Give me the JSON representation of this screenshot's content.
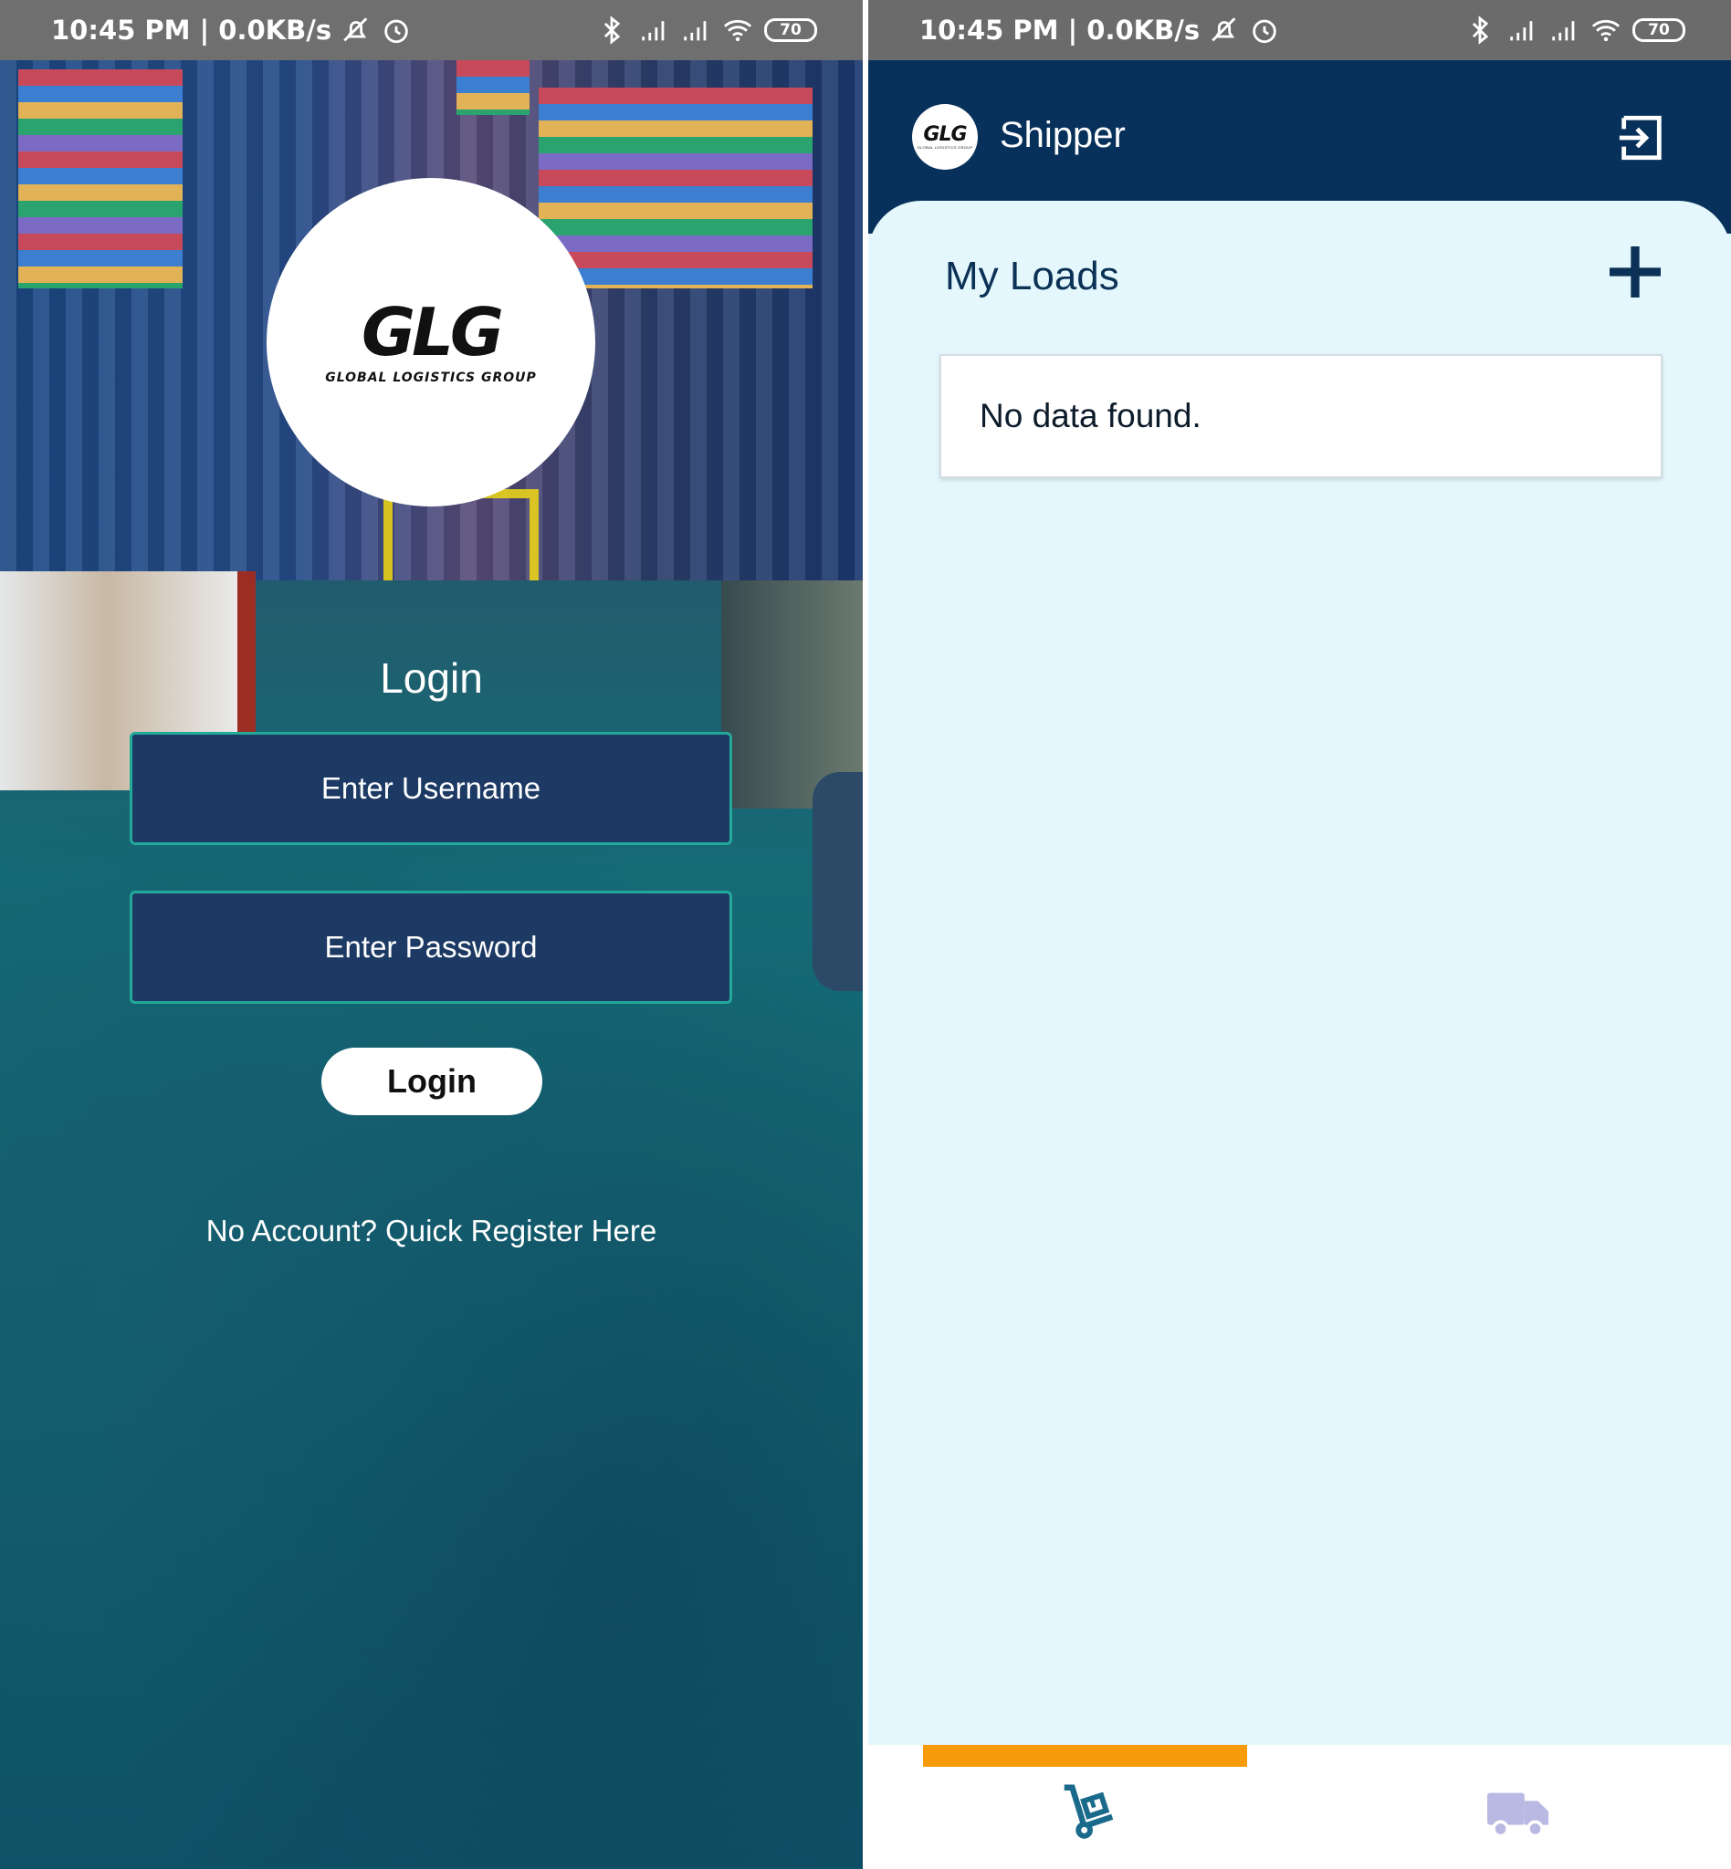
{
  "status_bar": {
    "time_network": "10:45 PM | 0.0KB/s",
    "battery": "70"
  },
  "login_screen": {
    "logo": {
      "mark": "GLG",
      "tagline": "GLOBAL LOGISTICS GROUP"
    },
    "title": "Login",
    "username_placeholder": "Enter Username",
    "password_placeholder": "Enter Password",
    "login_button": "Login",
    "register_link": "No Account? Quick Register Here"
  },
  "shipper_screen": {
    "header": {
      "logo_mark": "GLG",
      "logo_tagline": "GLOBAL LOGISTICS GROUP",
      "title": "Shipper",
      "logout_icon": "logout-icon"
    },
    "section_title": "My Loads",
    "add_icon": "plus-icon",
    "empty_message": "No data found.",
    "bottom_nav": {
      "tabs": [
        {
          "name": "loads",
          "icon": "hand-truck-icon",
          "active": true
        },
        {
          "name": "trucks",
          "icon": "truck-icon",
          "active": false
        }
      ]
    },
    "colors": {
      "header": "#07305a",
      "content_bg": "#e3f7fc",
      "active_tab_indicator": "#f79b0b",
      "active_icon": "#1a6a8c",
      "inactive_icon": "#b9b9e3"
    }
  }
}
